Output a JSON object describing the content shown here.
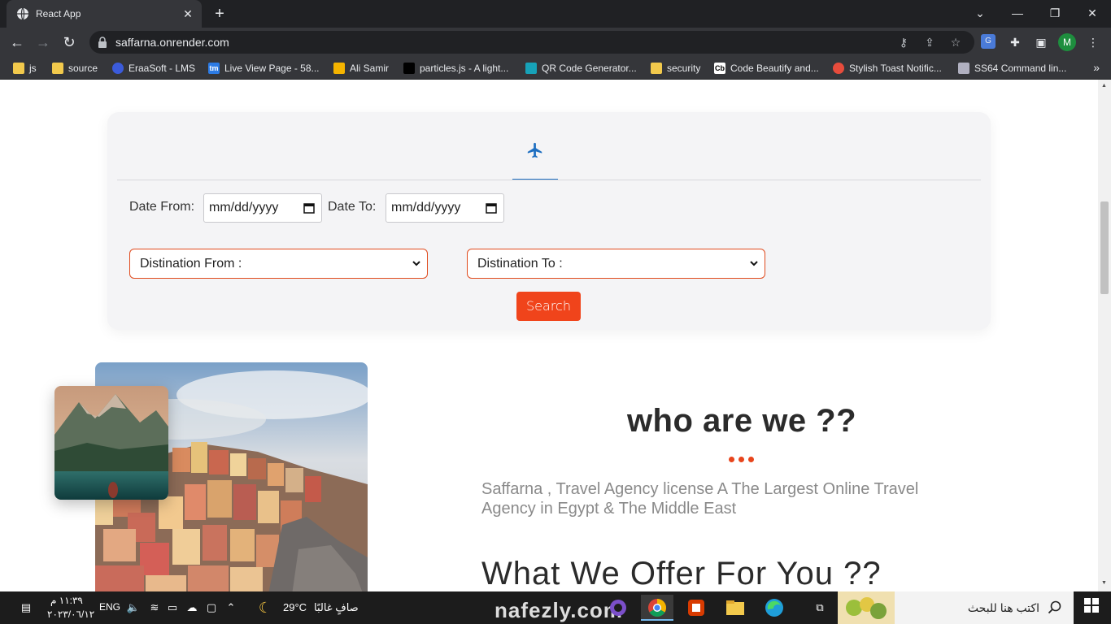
{
  "browser": {
    "tab_title": "React App",
    "url": "saffarna.onrender.com",
    "profile_initial": "M",
    "bookmarks": [
      {
        "label": "js",
        "icon": "folder-icon"
      },
      {
        "label": "source",
        "icon": "folder-icon"
      },
      {
        "label": "EraaSoft - LMS",
        "icon": "eraasoft-icon"
      },
      {
        "label": "Live View Page - 58...",
        "icon": "tm-icon"
      },
      {
        "label": "Ali Samir",
        "icon": "ali-icon"
      },
      {
        "label": "particles.js - A light...",
        "icon": "particles-icon"
      },
      {
        "label": "QR Code Generator...",
        "icon": "qr-icon"
      },
      {
        "label": "security",
        "icon": "folder-icon"
      },
      {
        "label": "Code Beautify and...",
        "icon": "cb-icon"
      },
      {
        "label": "Stylish Toast Notific...",
        "icon": "toast-icon"
      },
      {
        "label": "SS64 Command lin...",
        "icon": "ss64-icon"
      }
    ],
    "bookmark_tm_badge": "tm",
    "bookmark_cb_badge": "Cb"
  },
  "search_form": {
    "active_tab_icon": "plane-icon",
    "date_from_label": "Date From:",
    "date_from_value": "mm/dd/yyyy",
    "date_to_label": "Date To:",
    "date_to_value": "mm/dd/yyyy",
    "destination_from": "Distination From :",
    "destination_to": "Distination To :",
    "search_label": "Search"
  },
  "about": {
    "title": "who are we ??",
    "text": "Saffarna , Travel Agency license A The Largest Online Travel Agency in Egypt & The Middle East",
    "offer_title": "What We Offer For You ??"
  },
  "taskbar": {
    "time": "١١:٣٩ م",
    "date": "٢٠٢٣/٠٦/١٢",
    "language": "ENG",
    "temperature": "29°C",
    "weather": "صافٍ غالبًا",
    "search_placeholder": "اكتب هنا للبحث",
    "watermark": "nafezly.com"
  },
  "colors": {
    "accent": "#f0441b",
    "plane_blue": "#1f6fc1",
    "title_dark": "#2b2b2b"
  }
}
